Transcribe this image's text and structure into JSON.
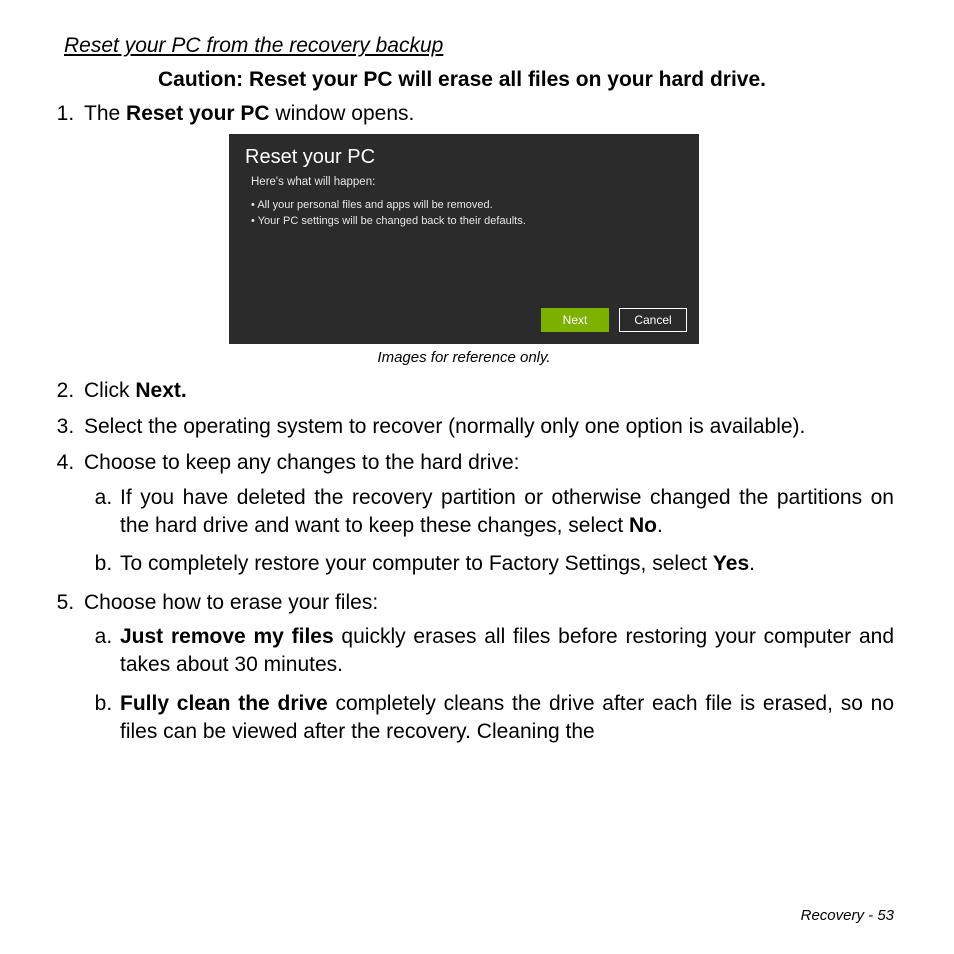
{
  "section_title": "Reset your PC from the recovery backup",
  "caution": "Caution: Reset your PC will erase all files on your hard drive.",
  "steps": {
    "s1": {
      "pre": "The ",
      "bold": "Reset your PC",
      "post": " window opens."
    },
    "s2": {
      "pre": "Click ",
      "bold": "Next."
    },
    "s3": "Select the operating system to recover (normally only one option is available).",
    "s4": "Choose to keep any changes to the hard drive:",
    "s4a": {
      "pre": "If you have deleted the recovery partition or otherwise changed the partitions on the hard drive and want to keep these changes, select ",
      "bold": "No",
      "post": "."
    },
    "s4b": {
      "pre": "To completely restore your computer to Factory Settings, select ",
      "bold": "Yes",
      "post": "."
    },
    "s5": "Choose how to erase your files:",
    "s5a": {
      "bold": "Just remove my files",
      "post": " quickly erases all files before restoring your computer and takes about 30 minutes."
    },
    "s5b": {
      "bold": "Fully clean the drive",
      "post": " completely cleans the drive after each file is erased, so no files can be viewed after the recovery. Cleaning the"
    }
  },
  "dialog": {
    "title": "Reset your PC",
    "subtitle": "Here's what will happen:",
    "bullets": {
      "b1": "All your personal files and apps will be removed.",
      "b2": "Your PC settings will be changed back to their defaults."
    },
    "next_label": "Next",
    "cancel_label": "Cancel"
  },
  "caption": "Images for reference only.",
  "footer": {
    "section": "Recovery - ",
    "page": " 53"
  }
}
